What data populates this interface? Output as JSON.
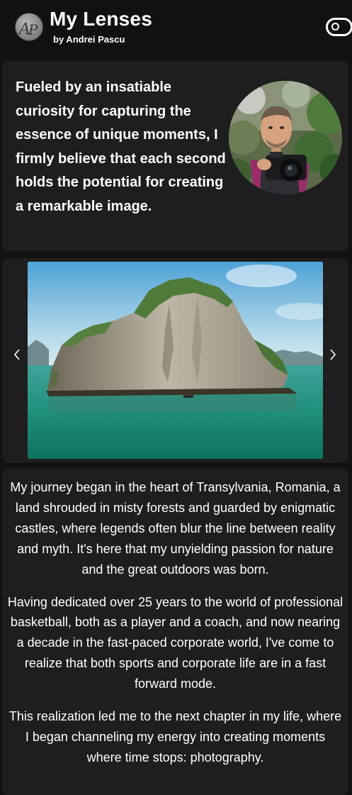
{
  "header": {
    "logo_icon": "ap-monogram-icon",
    "title": "My Lenses",
    "byline": "by Andrei Pascu",
    "theme_toggle_icon": "toggle-icon"
  },
  "intro": {
    "quote": "Fueled by an insatiable curiosity for capturing the essence of unique moments, I firmly believe that each second holds the potential for creating a remarkable image.",
    "portrait_icon": "portrait-photo"
  },
  "carousel": {
    "image_icon": "limestone-island-photo",
    "prev_icon": "chevron-left-icon",
    "next_icon": "chevron-right-icon"
  },
  "story": {
    "paragraphs": [
      "My journey began in the heart of Transylvania, Romania, a land shrouded in misty forests and guarded by enigmatic castles, where legends often blur the line between reality and myth. It's here that my unyielding passion for nature and the great outdoors was born.",
      "Having dedicated over 25 years to the world of professional basketball, both as a player and a coach, and now nearing a decade in the fast-paced corporate world, I've come to realize that both sports and corporate life are in a fast forward mode.",
      "This realization led me to the next chapter in my life, where I began channeling my energy into creating moments where time stops: photography."
    ]
  },
  "colors": {
    "background": "#121212",
    "header": "#111111",
    "card": "#1e1e1e",
    "text": "#ffffff"
  }
}
